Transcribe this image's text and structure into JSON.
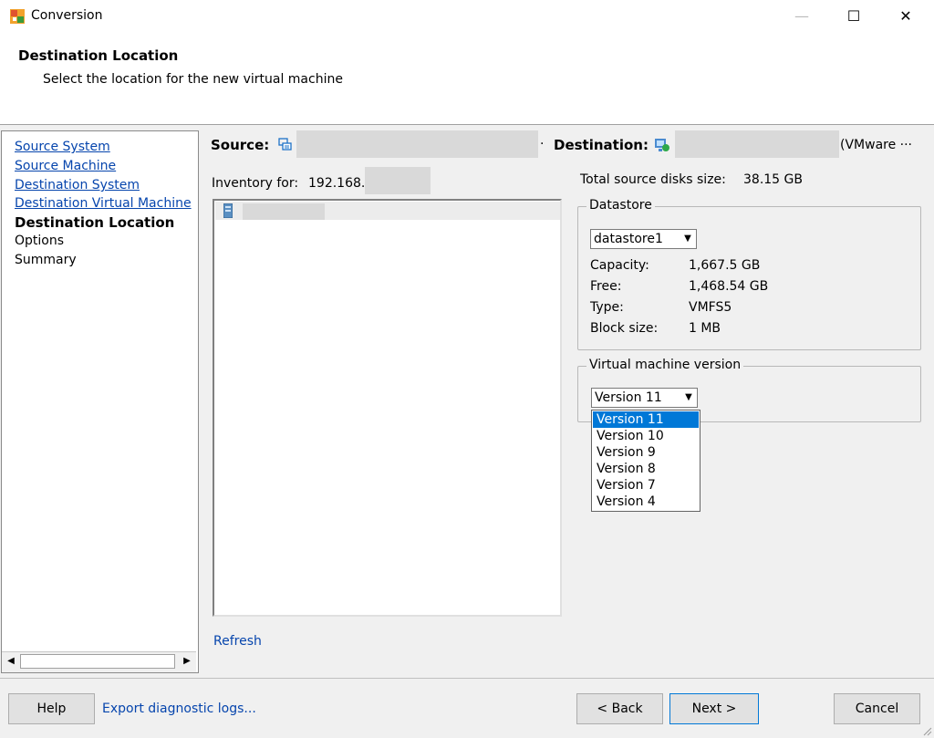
{
  "window": {
    "title": "Conversion",
    "minimize_glyph": "—",
    "maximize_glyph": "☐",
    "close_glyph": "✕"
  },
  "header": {
    "title": "Destination Location",
    "subtitle": "Select the location for the new virtual machine"
  },
  "nav": {
    "items": [
      {
        "label": "Source System",
        "state": "link"
      },
      {
        "label": "Source Machine",
        "state": "link"
      },
      {
        "label": "Destination System",
        "state": "link"
      },
      {
        "label": "Destination Virtual Machine",
        "state": "link"
      },
      {
        "label": "Destination Location",
        "state": "current"
      },
      {
        "label": "Options",
        "state": "plain"
      },
      {
        "label": "Summary",
        "state": "plain"
      }
    ]
  },
  "source": {
    "label": "Source:",
    "icon": "source-machine-icon",
    "separator": "·"
  },
  "destination": {
    "label": "Destination:",
    "icon": "vmware-host-icon",
    "suffix": "(VMware ···"
  },
  "inventory": {
    "label": "Inventory for:",
    "host_prefix": "192.168.",
    "tree_icon": "server-icon"
  },
  "refresh_label": "Refresh",
  "total_source": {
    "label": "Total source disks size:",
    "value": "38.15 GB"
  },
  "datastore": {
    "legend": "Datastore",
    "selected": "datastore1",
    "details": [
      {
        "key": "Capacity:",
        "value": "1,667.5 GB"
      },
      {
        "key": "Free:",
        "value": "1,468.54 GB"
      },
      {
        "key": "Type:",
        "value": "VMFS5"
      },
      {
        "key": "Block size:",
        "value": "1 MB"
      }
    ]
  },
  "vm_version": {
    "legend": "Virtual machine version",
    "selected": "Version 11",
    "options": [
      "Version 11",
      "Version 10",
      "Version 9",
      "Version 8",
      "Version 7",
      "Version 4"
    ]
  },
  "footer": {
    "help": "Help",
    "export_logs": "Export diagnostic logs...",
    "back": "< Back",
    "next": "Next >",
    "cancel": "Cancel"
  },
  "colors": {
    "accent": "#0078d7",
    "link": "#0645ad",
    "redaction": "#d9d9d9"
  }
}
